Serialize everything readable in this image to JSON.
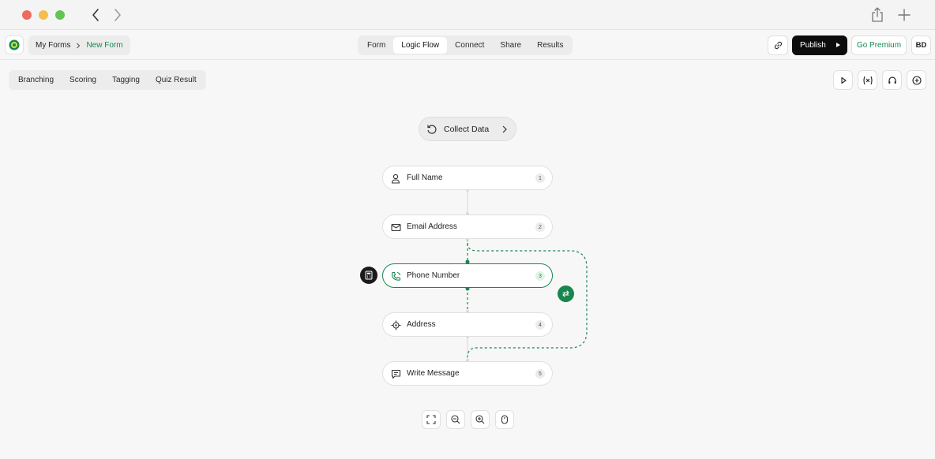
{
  "breadcrumb": {
    "root": "My Forms",
    "current": "New Form"
  },
  "tabs": [
    {
      "label": "Form",
      "active": false
    },
    {
      "label": "Logic Flow",
      "active": true
    },
    {
      "label": "Connect",
      "active": false
    },
    {
      "label": "Share",
      "active": false
    },
    {
      "label": "Results",
      "active": false
    }
  ],
  "actions": {
    "publish": "Publish",
    "premium": "Go Premium",
    "avatar": "BD"
  },
  "subtabs": [
    "Branching",
    "Scoring",
    "Tagging",
    "Quiz Result"
  ],
  "flow": {
    "collect_label": "Collect Data",
    "nodes": [
      {
        "label": "Full Name",
        "badge": "1",
        "icon": "person-icon"
      },
      {
        "label": "Email Address",
        "badge": "2",
        "icon": "mail-icon"
      },
      {
        "label": "Phone Number",
        "badge": "3",
        "icon": "phone-icon"
      },
      {
        "label": "Address",
        "badge": "4",
        "icon": "location-icon"
      },
      {
        "label": "Write Message",
        "badge": "5",
        "icon": "message-icon"
      }
    ]
  },
  "colors": {
    "accent": "#17864f",
    "dark": "#0c0c0c"
  }
}
